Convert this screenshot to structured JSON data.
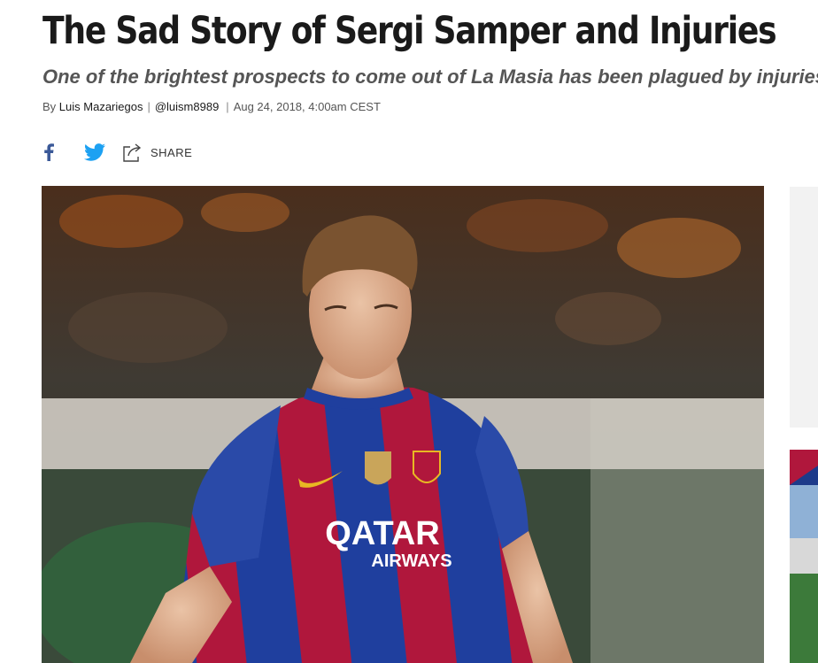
{
  "article": {
    "headline": "The Sad Story of Sergi Samper and Injuries",
    "dek": "One of the brightest prospects to come out of La Masia has been plagued by injuries",
    "byline": {
      "prefix": "By",
      "author": "Luis Mazariegos",
      "handle": "@luism8989",
      "date": "Aug 24, 2018, 4:00am CEST"
    }
  },
  "share": {
    "share_label": "SHARE",
    "icons": [
      "facebook-icon",
      "twitter-icon",
      "share-icon"
    ]
  },
  "hero_image": {
    "jersey_sponsor": "QATAR AIRWAYS",
    "colors": {
      "blue": "#1f3f9e",
      "red": "#b0173c",
      "gold": "#e8b823"
    }
  },
  "colors": {
    "text": "#1a1a1a",
    "dek": "#555555",
    "facebook": "#3b5998",
    "twitter": "#1da1f2"
  }
}
